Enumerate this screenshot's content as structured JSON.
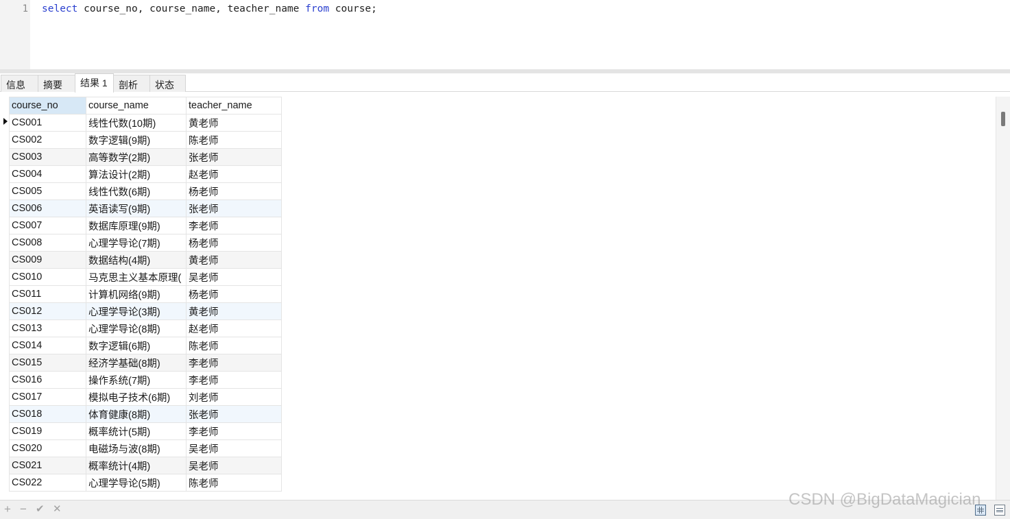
{
  "editor": {
    "line_number": "1",
    "sql": {
      "kw_select": "select",
      "columns": " course_no, course_name, teacher_name ",
      "kw_from": "from",
      "table": " course;"
    }
  },
  "tabs": [
    {
      "label": "信息"
    },
    {
      "label": "摘要"
    },
    {
      "label": "结果 1",
      "active": true
    },
    {
      "label": "剖析"
    },
    {
      "label": "状态"
    }
  ],
  "grid": {
    "columns": [
      "course_no",
      "course_name",
      "teacher_name"
    ],
    "sorted_column": "course_no",
    "rows": [
      [
        "CS001",
        "线性代数(10期)",
        "黄老师"
      ],
      [
        "CS002",
        "数字逻辑(9期)",
        "陈老师"
      ],
      [
        "CS003",
        "高等数学(2期)",
        "张老师"
      ],
      [
        "CS004",
        "算法设计(2期)",
        "赵老师"
      ],
      [
        "CS005",
        "线性代数(6期)",
        "杨老师"
      ],
      [
        "CS006",
        "英语读写(9期)",
        "张老师"
      ],
      [
        "CS007",
        "数据库原理(9期)",
        "李老师"
      ],
      [
        "CS008",
        "心理学导论(7期)",
        "杨老师"
      ],
      [
        "CS009",
        "数据结构(4期)",
        "黄老师"
      ],
      [
        "CS010",
        "马克思主义基本原理(",
        "吴老师"
      ],
      [
        "CS011",
        "计算机网络(9期)",
        "杨老师"
      ],
      [
        "CS012",
        "心理学导论(3期)",
        "黄老师"
      ],
      [
        "CS013",
        "心理学导论(8期)",
        "赵老师"
      ],
      [
        "CS014",
        "数字逻辑(6期)",
        "陈老师"
      ],
      [
        "CS015",
        "经济学基础(8期)",
        "李老师"
      ],
      [
        "CS016",
        "操作系统(7期)",
        "李老师"
      ],
      [
        "CS017",
        "模拟电子技术(6期)",
        "刘老师"
      ],
      [
        "CS018",
        "体育健康(8期)",
        "张老师"
      ],
      [
        "CS019",
        "概率统计(5期)",
        "李老师"
      ],
      [
        "CS020",
        "电磁场与波(8期)",
        "吴老师"
      ],
      [
        "CS021",
        "概率统计(4期)",
        "吴老师"
      ],
      [
        "CS022",
        "心理学导论(5期)",
        "陈老师"
      ]
    ]
  },
  "toolbar": {
    "add": "+",
    "remove": "−",
    "apply": "✔",
    "discard": "✕"
  },
  "watermark": "CSDN @BigDataMagician",
  "colors": {
    "keyword": "#2a3fcf",
    "sorted_header": "#d7e8f6"
  }
}
